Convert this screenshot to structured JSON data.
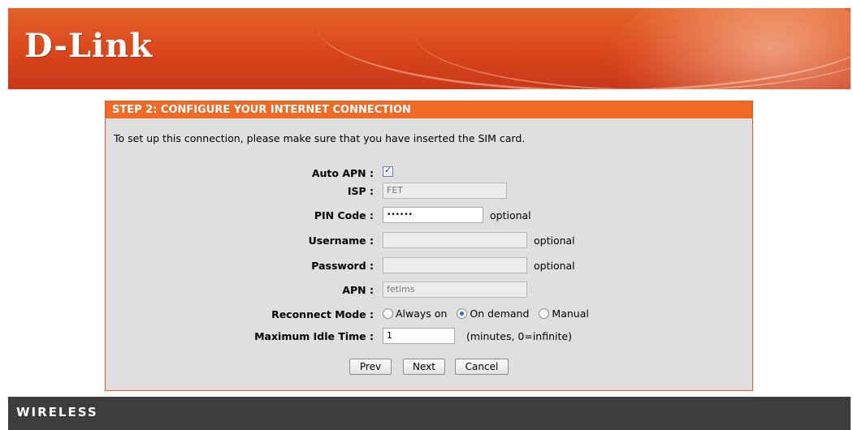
{
  "header": {
    "logo_text": "D-Link",
    "brand_color": "#d9461b"
  },
  "step": {
    "title": "STEP 2: CONFIGURE YOUR INTERNET CONNECTION",
    "intro": "To set up this connection, please make sure that you have inserted the SIM card.",
    "accent_color": "#f06a26"
  },
  "form": {
    "auto_apn": {
      "label": "Auto APN :",
      "checked": true
    },
    "isp": {
      "label": "ISP :",
      "value": "FET",
      "disabled": true
    },
    "pin_code": {
      "label": "PIN Code :",
      "value": "••••••",
      "hint": "optional"
    },
    "username": {
      "label": "Username :",
      "value": "",
      "hint": "optional",
      "disabled": true
    },
    "password": {
      "label": "Password :",
      "value": "",
      "hint": "optional",
      "disabled": true
    },
    "apn": {
      "label": "APN :",
      "value": "fetims",
      "disabled": true
    },
    "reconnect_mode": {
      "label": "Reconnect Mode :",
      "options": [
        "Always on",
        "On demand",
        "Manual"
      ],
      "selected": "On demand"
    },
    "max_idle_time": {
      "label": "Maximum Idle Time :",
      "value": "1",
      "hint": "(minutes, 0=infinite)"
    }
  },
  "buttons": {
    "prev": "Prev",
    "next": "Next",
    "cancel": "Cancel"
  },
  "footer": {
    "text": "WIRELESS"
  }
}
